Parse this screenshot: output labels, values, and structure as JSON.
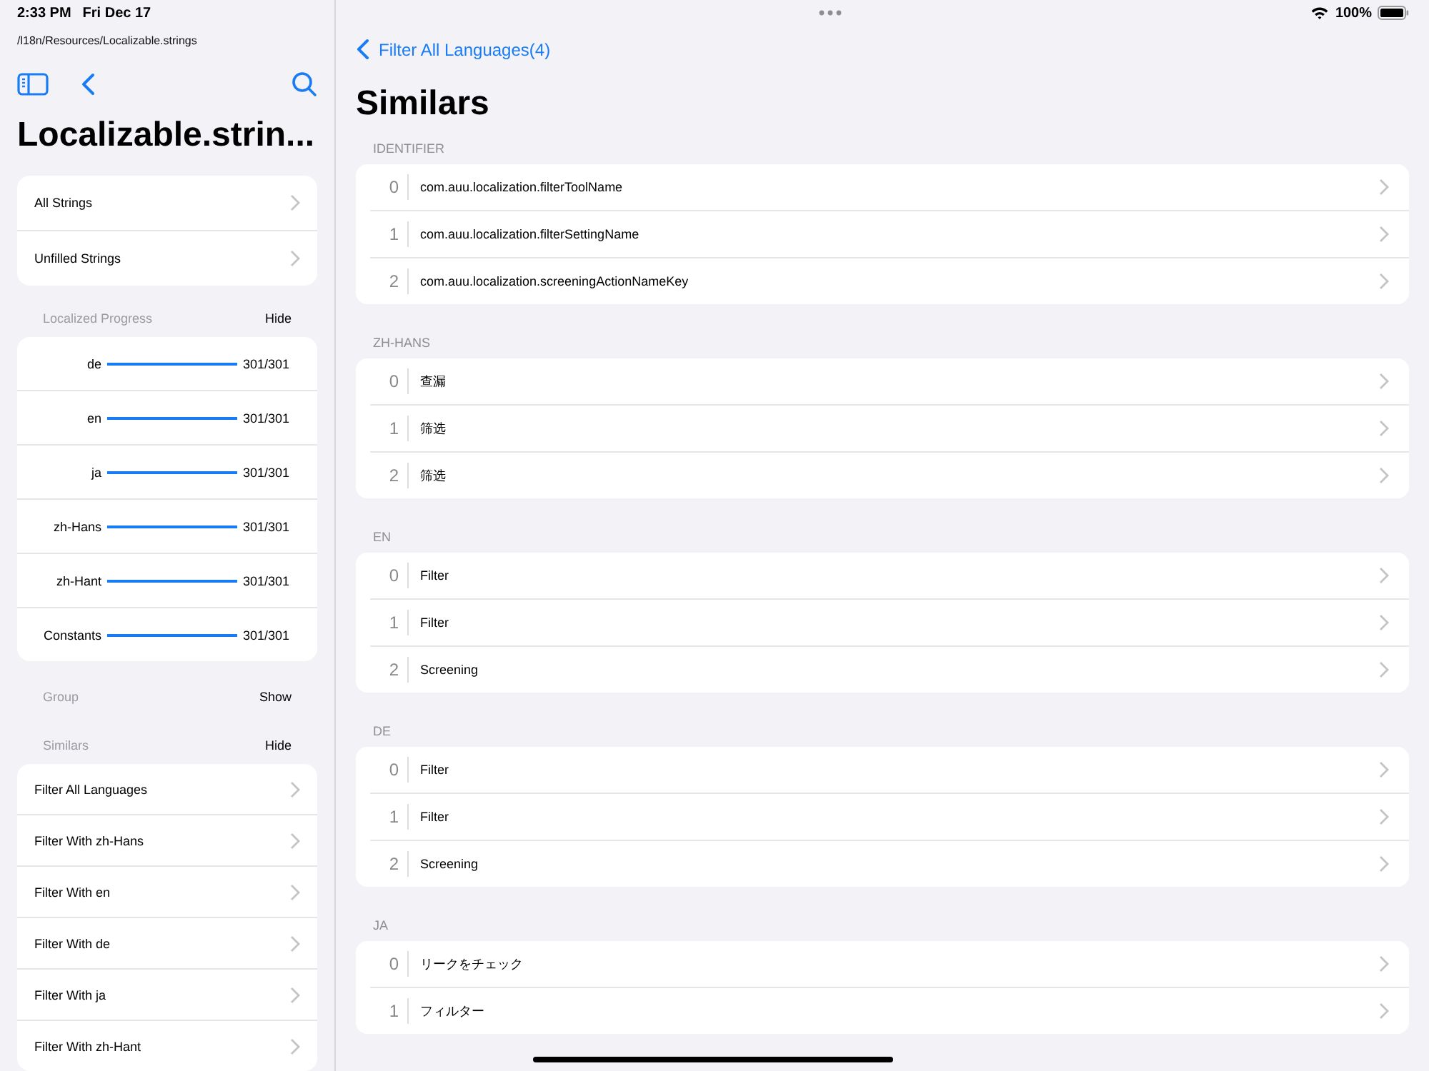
{
  "status_bar": {
    "time": "2:33 PM",
    "date": "Fri Dec 17",
    "battery": "100%"
  },
  "sidebar": {
    "path": "/l18n/Resources/Localizable.strings",
    "title": "Localizable.strin...",
    "nav_items": [
      "All Strings",
      "Unfilled Strings"
    ],
    "progress_section": {
      "title": "Localized Progress",
      "toggle": "Hide",
      "rows": [
        {
          "language": "de",
          "level": 1,
          "count": "301/301"
        },
        {
          "language": "en",
          "level": 1,
          "count": "301/301"
        },
        {
          "language": "ja",
          "level": 1,
          "count": "301/301"
        },
        {
          "language": "zh-Hans",
          "level": 1,
          "count": "301/301"
        },
        {
          "language": "zh-Hant",
          "level": 1,
          "count": "301/301"
        },
        {
          "language": "Constants",
          "level": 1,
          "count": "301/301"
        }
      ]
    },
    "group_section": {
      "title": "Group",
      "toggle": "Show"
    },
    "similars_section": {
      "title": "Similars",
      "toggle": "Hide",
      "items": [
        "Filter All Languages",
        "Filter With zh-Hans",
        "Filter With en",
        "Filter With de",
        "Filter With ja",
        "Filter With zh-Hant"
      ]
    }
  },
  "detail": {
    "back_label": "Filter All Languages(4)",
    "title": "Similars",
    "sections": [
      {
        "header": "IDENTIFIER",
        "rows": [
          {
            "index": "0",
            "text": "com.auu.localization.filterToolName"
          },
          {
            "index": "1",
            "text": "com.auu.localization.filterSettingName"
          },
          {
            "index": "2",
            "text": "com.auu.localization.screeningActionNameKey"
          }
        ]
      },
      {
        "header": "ZH-HANS",
        "rows": [
          {
            "index": "0",
            "text": "查漏"
          },
          {
            "index": "1",
            "text": "筛选"
          },
          {
            "index": "2",
            "text": "筛选"
          }
        ]
      },
      {
        "header": "EN",
        "rows": [
          {
            "index": "0",
            "text": "Filter"
          },
          {
            "index": "1",
            "text": "Filter"
          },
          {
            "index": "2",
            "text": "Screening"
          }
        ]
      },
      {
        "header": "DE",
        "rows": [
          {
            "index": "0",
            "text": "Filter"
          },
          {
            "index": "1",
            "text": "Filter"
          },
          {
            "index": "2",
            "text": "Screening"
          }
        ]
      },
      {
        "header": "JA",
        "rows": [
          {
            "index": "0",
            "text": "リークをチェック"
          },
          {
            "index": "1",
            "text": "フィルター"
          }
        ]
      }
    ]
  }
}
